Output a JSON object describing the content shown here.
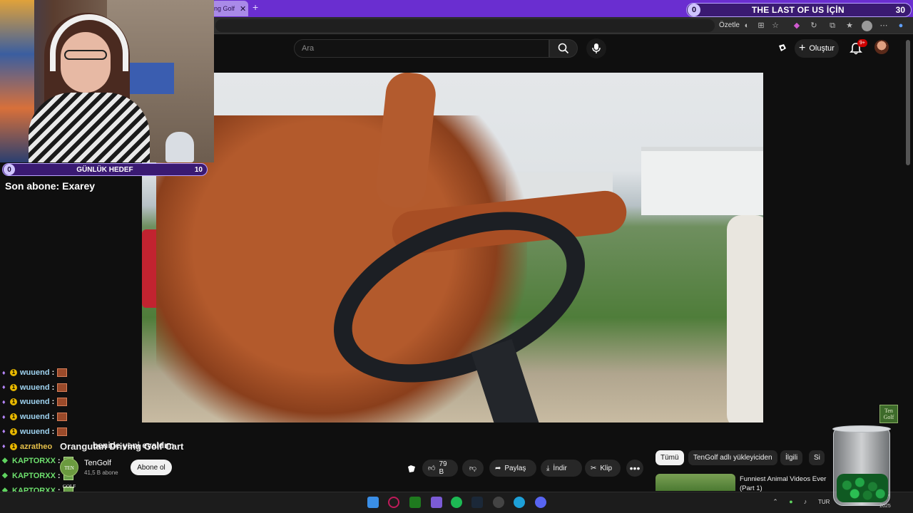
{
  "browser": {
    "active_tab_title": "ng Golf",
    "active_tab_close": "✕",
    "new_tab": "+",
    "summarize_label": "Özetle"
  },
  "overlay": {
    "top_goal": {
      "current": "0",
      "label": "THE LAST OF US İÇİN",
      "target": "30"
    },
    "daily_goal": {
      "current": "0",
      "label": "GÜNLÜK HEDEF",
      "target": "10"
    },
    "last_sub": "Son abone: Exarey"
  },
  "youtube": {
    "search_placeholder": "Ara",
    "create_label": "Oluştur",
    "notif_count": "9+",
    "video_title": "Orangutan Driving Golf Cart",
    "overlapping_chat_text": "benide yeni eyaldım",
    "watermark": "Ten Golf",
    "channel": {
      "name": "TenGolf",
      "subs": "41,5 B abone",
      "subscribe": "Abone ol",
      "avatar_text": "TEN GOLF"
    },
    "actions": {
      "likes": "79 B",
      "share": "Paylaş",
      "download": "İndir",
      "clip": "Klip",
      "more": "•••"
    },
    "chips": [
      "Tümü",
      "TenGolf adlı yükleyiciden",
      "İlgili",
      "Si"
    ],
    "rec": {
      "title": "Funniest Animal Videos Ever (Part 1)"
    }
  },
  "chat": [
    {
      "user": "wuuend",
      "type": "w"
    },
    {
      "user": "wuuend",
      "type": "w"
    },
    {
      "user": "wuuend",
      "type": "w"
    },
    {
      "user": "wuuend",
      "type": "w"
    },
    {
      "user": "wuuend",
      "type": "w"
    },
    {
      "user": "azratheo",
      "type": "a"
    },
    {
      "user": "KAPTORXX",
      "type": "k"
    },
    {
      "user": "KAPTORXX",
      "type": "k"
    },
    {
      "user": "KAPTORXX",
      "type": "k"
    },
    {
      "user": "KAPTORXX",
      "type": "k"
    }
  ],
  "taskbar": {
    "lang": "TUR",
    "clock_partial": "47",
    "date_partial": "2025"
  },
  "colors": {
    "overlay_purple": "#3a1a72",
    "tab_strip": "#6a2ed0",
    "yt_bg": "#0f0f0f",
    "kaptor_green": "#6ee06e",
    "wuuend_blue": "#9fd3f0"
  }
}
